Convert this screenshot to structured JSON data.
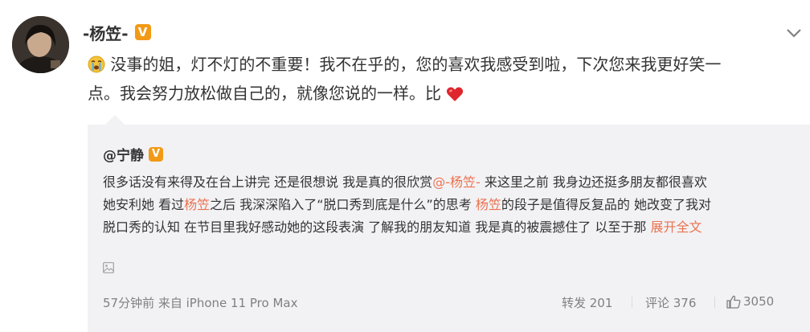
{
  "post": {
    "author": "-杨笠-",
    "verified_badge": "V",
    "text_line1": "没事的姐，灯不灯的不重要！我不在乎的，您的喜欢我感受到啦，下次您来我更好笑一",
    "text_line2": "点。我会努力放松做自己的，就像您说的一样。比",
    "emoji_start": "sob-emoji",
    "emoji_end": "red-heart-emoji"
  },
  "repost": {
    "author": "@宁静",
    "verified_badge": "V",
    "line1_a": "很多话没有来得及在台上讲完 还是很想说 我是真的很欣赏",
    "line1_mention": "@-杨笠-",
    "line1_b": " 来这里之前 我身边还挺多朋友都很喜欢",
    "line2_a": "她安利她 看过",
    "line2_link": "杨笠",
    "line2_b": "之后 我深深陷入了“脱口秀到底是什么”的思考 ",
    "line2_link2": "杨笠",
    "line2_c": "的段子是值得反复品的 她改变了我对",
    "line3_a": "脱口秀的认知 在节目里我好感动她的这段表演 了解我的朋友知道 我是真的被震撼住了 以至于那 ",
    "expand": "展开全文",
    "meta": "57分钟前 来自 iPhone 11 Pro Max",
    "actions": {
      "forward": "转发 201",
      "comment": "评论 376",
      "like_count": "3050"
    }
  },
  "colors": {
    "accent_link": "#eb7350",
    "repost_background": "#f2f2f5",
    "verified_badge": "#f29a16",
    "text": "#333333",
    "meta_text": "#808080"
  },
  "icons": [
    "chevron-down-icon",
    "picture-icon",
    "thumbs-up-icon"
  ]
}
